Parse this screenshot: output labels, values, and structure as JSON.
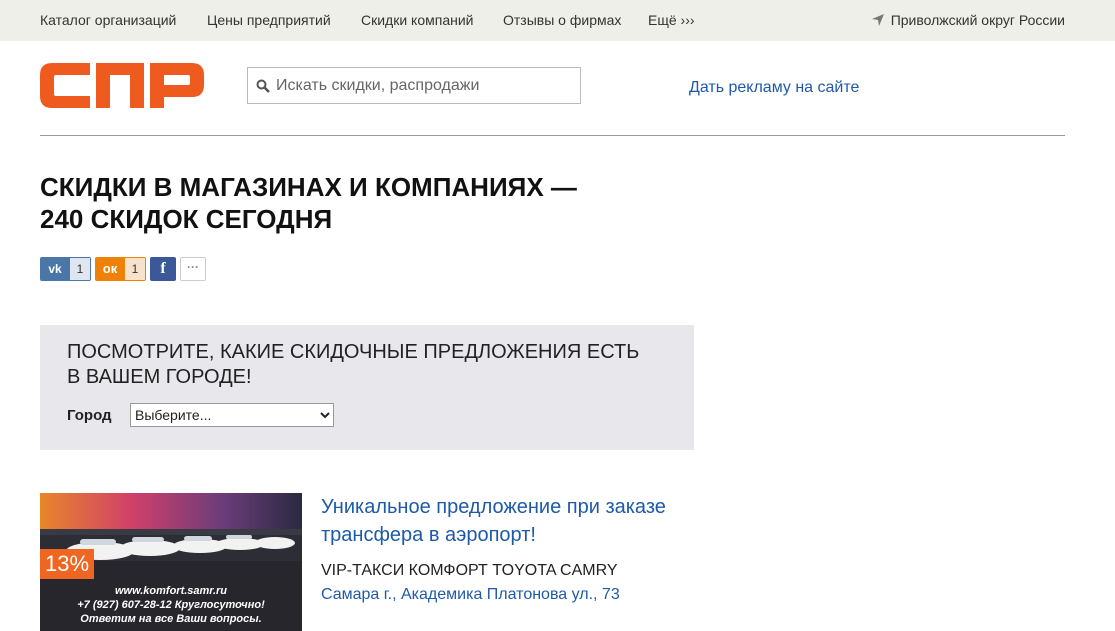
{
  "topnav": {
    "items": [
      {
        "label": "Каталог организаций"
      },
      {
        "label": "Цены предприятий"
      },
      {
        "label": "Скидки компаний"
      },
      {
        "label": "Отзывы о фирмах"
      },
      {
        "label": "Ещё ›››"
      }
    ],
    "region": "Приволжский округ России",
    "region_icon": "location-arrow-icon"
  },
  "header": {
    "logo_text": "СПР",
    "logo_color": "#ef5a1e",
    "search_placeholder": "Искать скидки, распродажи",
    "search_icon": "search-icon",
    "ad_link": "Дать рекламу на сайте"
  },
  "page": {
    "title_line1": "СКИДКИ В МАГАЗИНАХ И КОМПАНИЯХ —",
    "title_line2": "240 СКИДОК СЕГОДНЯ"
  },
  "social": {
    "vk": {
      "icon": "vk-icon",
      "count": "1",
      "color": "#4a76a8"
    },
    "ok": {
      "icon": "odnoklassniki-icon",
      "count": "1",
      "color": "#ee8208"
    },
    "fb": {
      "icon": "facebook-icon",
      "color": "#3b5998"
    },
    "more": {
      "icon": "more-dots-icon"
    }
  },
  "city_filter": {
    "heading_line1": "ПОСМОТРИТЕ, КАКИЕ СКИДОЧНЫЕ ПРЕДЛОЖЕНИЯ ЕСТЬ",
    "heading_line2": "В ВАШЕМ ГОРОДЕ!",
    "label": "Город",
    "selected": "Выберите..."
  },
  "offer": {
    "discount": "13%",
    "image_caption_1": "www.komfort.samr.ru",
    "image_caption_2": "+7 (927) 607-28-12 Круглосуточно!",
    "image_caption_3": "Ответим на все Ваши вопросы.",
    "title_line1": "Уникальное предложение при заказе",
    "title_line2": "трансфера в аэропорт!",
    "company": "VIP-ТАКСИ КОМФОРТ TOYOTA CAMRY",
    "address": "Самара г., Академика Платонова ул., 73"
  }
}
